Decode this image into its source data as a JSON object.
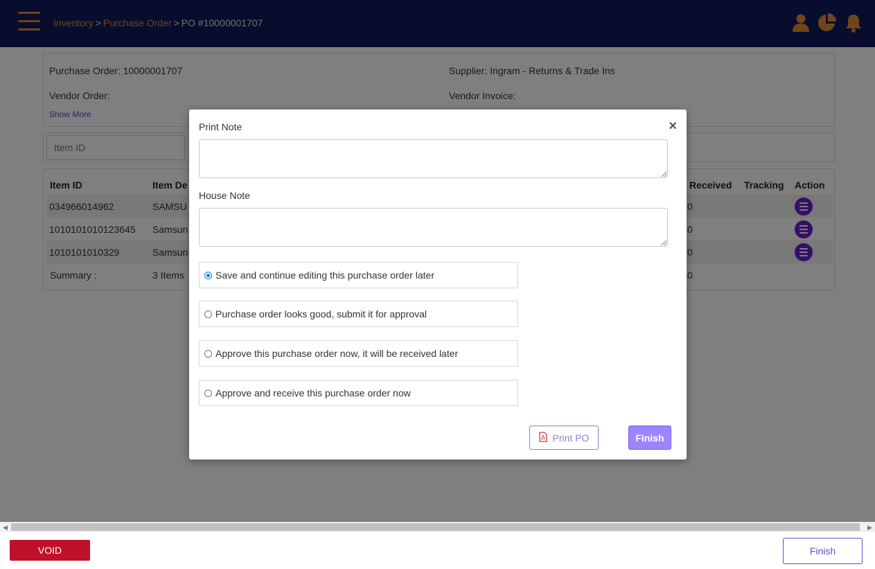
{
  "breadcrumb": {
    "items": [
      "Inventory",
      "Purchase Order"
    ],
    "separator": ">",
    "current": "PO #10000001707"
  },
  "header_icons": [
    "user-icon",
    "pie-chart-icon",
    "bell-icon"
  ],
  "info": {
    "purchase_order": "Purchase Order: 10000001707",
    "supplier": "Supplier: Ingram - Returns & Trade Ins",
    "vendor_order": "Vendor Order:",
    "vendor_invoice": "Vendor Invoice:",
    "show_more": "Show More"
  },
  "search": {
    "placeholder": "Item ID"
  },
  "table": {
    "headers": {
      "item_id": "Item ID",
      "item_desc": "Item De",
      "received": "Received",
      "tracking": "Tracking",
      "action": "Action"
    },
    "rows": [
      {
        "item_id": "034966014962",
        "item_desc": "SAMSU",
        "received": "0"
      },
      {
        "item_id": "1010101010123645",
        "item_desc": "Samsun",
        "received": "0"
      },
      {
        "item_id": "1010101010329",
        "item_desc": "Samsun",
        "received": "0"
      }
    ],
    "summary": {
      "label": "Summary :",
      "items": "3 Items",
      "received": "0"
    }
  },
  "modal": {
    "print_note_label": "Print Note",
    "house_note_label": "House Note",
    "close_symbol": "×",
    "options": [
      "Save and continue editing this purchase order later",
      "Purchase order looks good, submit it for approval",
      "Approve this purchase order now, it will be received later",
      "Approve and receive this purchase order now"
    ],
    "selected_option_index": 0,
    "print_button": "Print PO",
    "finish_button": "Finish"
  },
  "footer": {
    "void_button": "VOID",
    "finish_button": "Finish"
  },
  "colors": {
    "topbar": "#101a5c",
    "accent_orange": "#e08a2e",
    "action_purple": "#6a1fcf",
    "void_red": "#c0102a",
    "finish_purple": "#9b86ff"
  }
}
